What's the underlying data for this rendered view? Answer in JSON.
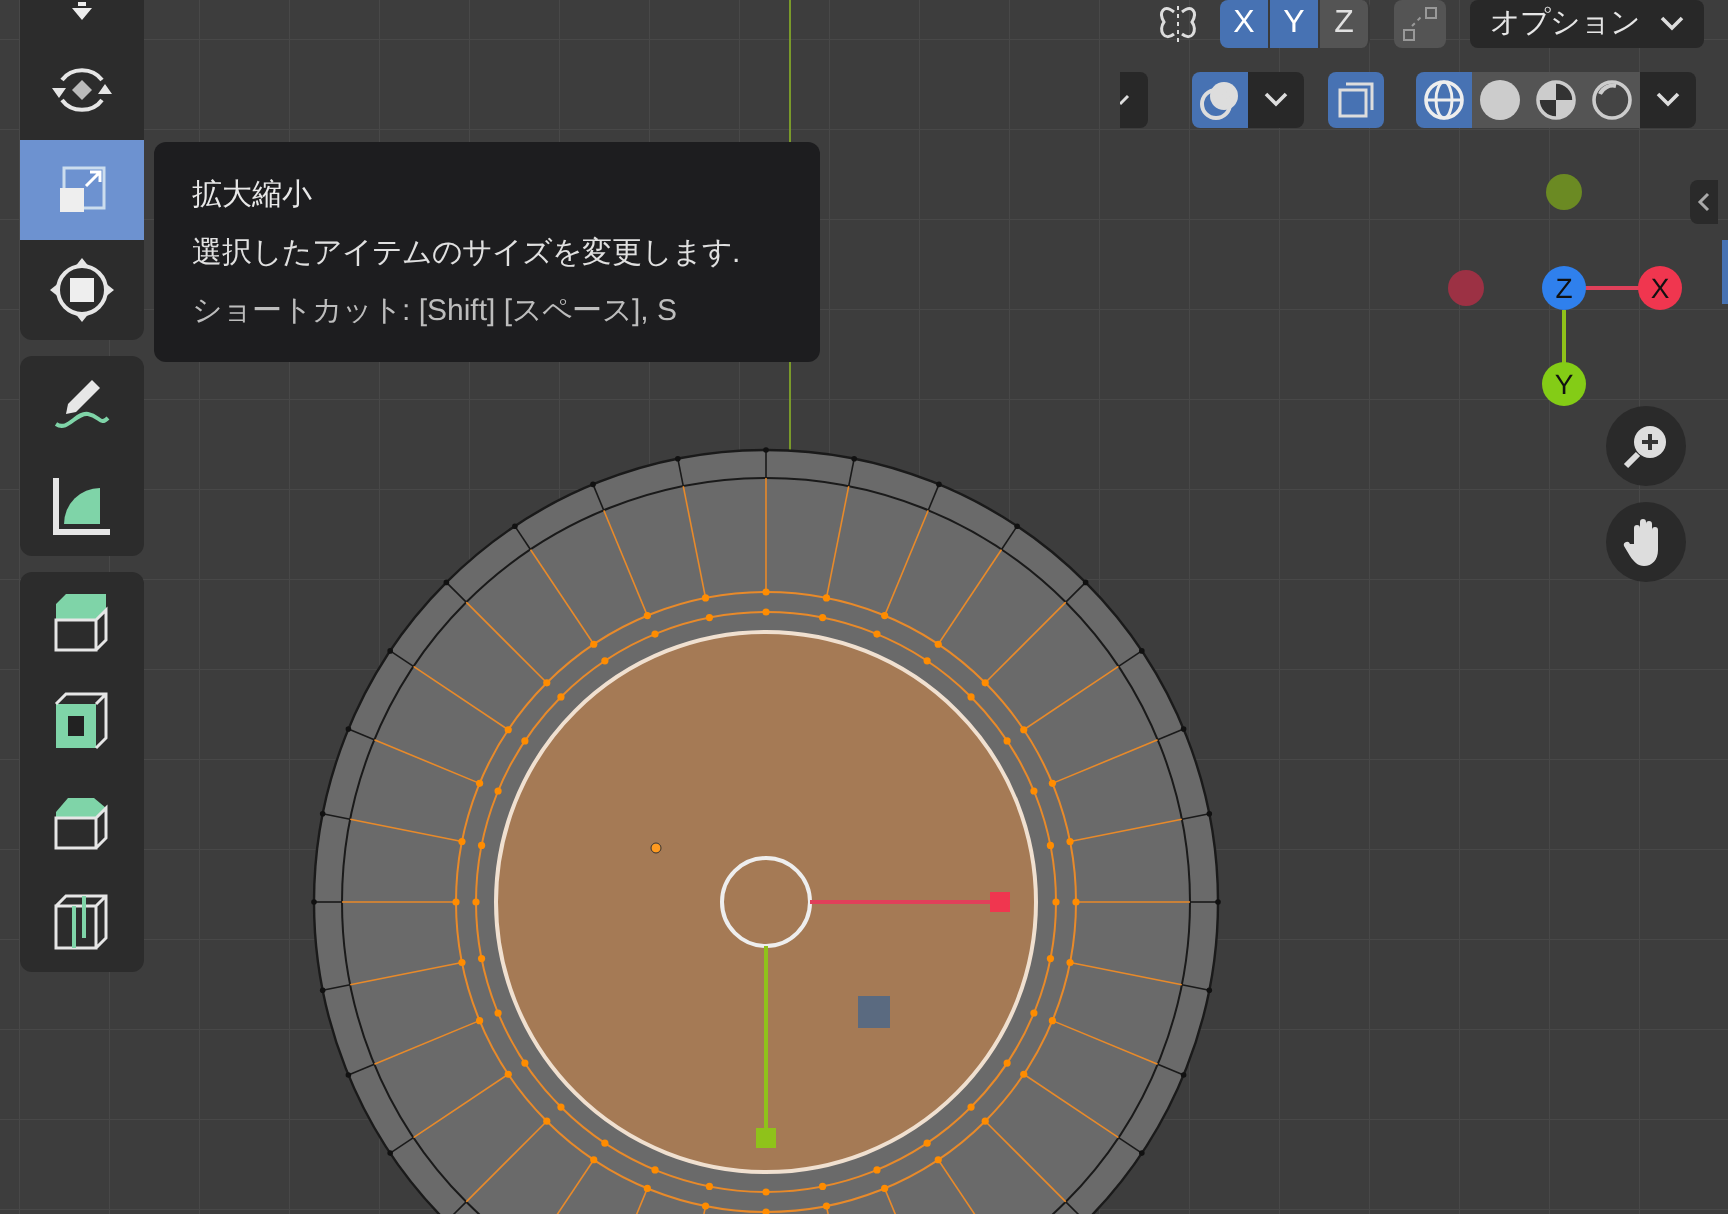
{
  "header": {
    "axes": [
      {
        "label": "X",
        "selected": true
      },
      {
        "label": "Y",
        "selected": true
      },
      {
        "label": "Z",
        "selected": false
      }
    ],
    "options_label": "オプション"
  },
  "shading": {
    "overlays_on": true,
    "xray_on": true,
    "modes": [
      {
        "kind": "wireframe",
        "selected": true
      },
      {
        "kind": "solid",
        "selected": false
      },
      {
        "kind": "material",
        "selected": false
      },
      {
        "kind": "rendered",
        "selected": false
      }
    ]
  },
  "toolbar": {
    "groups": [
      [
        {
          "kind": "rotate",
          "selected": false
        },
        {
          "kind": "scale",
          "selected": true
        },
        {
          "kind": "transform",
          "selected": false
        }
      ],
      [
        {
          "kind": "annotate",
          "selected": false
        },
        {
          "kind": "measure",
          "selected": false
        }
      ],
      [
        {
          "kind": "extrude",
          "selected": false
        },
        {
          "kind": "inset",
          "selected": false
        },
        {
          "kind": "bevel",
          "selected": false
        },
        {
          "kind": "loopcut",
          "selected": false
        }
      ]
    ]
  },
  "tooltip": {
    "title": "拡大縮小",
    "description": "選択したアイテムのサイズを変更します.",
    "shortcut": "ショートカット: [Shift] [スペース], S"
  },
  "gizmo": {
    "axes": [
      {
        "label": "Z",
        "color": "#2f80ed"
      },
      {
        "label": "X",
        "color": "#f0364f"
      },
      {
        "label": "Y",
        "color": "#84cc16"
      }
    ]
  }
}
